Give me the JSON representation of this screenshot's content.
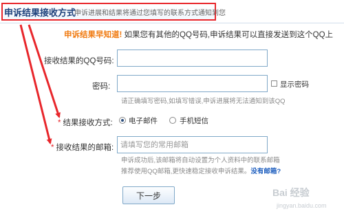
{
  "header": {
    "title": "申诉结果接收方式",
    "subtitle": "申诉进展和结果将通过您填写的联系方式通知到您"
  },
  "notice": {
    "lead": "申诉结果早知道!",
    "text": " 如果您有其他的QQ号码,申诉结果可以直接发送到这个QQ上"
  },
  "form": {
    "qq_label": "接收结果的QQ号码:",
    "qq_value": "",
    "password_label": "密码:",
    "password_value": "",
    "show_password_label": "显示密码",
    "show_password_checked": false,
    "password_hint": "请正确填写密码,如填写错误,申诉进展将无法通知到该QQ",
    "method_required": "*",
    "method_label": "结果接收方式:",
    "method_options": [
      "电子邮件",
      "手机短信"
    ],
    "method_selected": "电子邮件",
    "email_required": "*",
    "email_label": "接收结果的邮箱:",
    "email_placeholder": "请填写您的常用邮箱",
    "email_value": "",
    "email_hint_1": "申诉成功后,该邮箱将自动设置为个人资料中的联系邮箱",
    "email_hint_2": "推荐使用QQ邮箱,更快速稳定接收申诉结果。",
    "no_email_link": "没有邮箱?",
    "next_button": "下一步"
  },
  "colors": {
    "annotation_red": "#e8262b",
    "title_blue": "#1b3f7a",
    "notice_orange": "#f07a10",
    "link_blue": "#1f5fbf"
  },
  "watermark": {
    "text": "Bai 经验",
    "url": "jingyan.baidu.com"
  }
}
